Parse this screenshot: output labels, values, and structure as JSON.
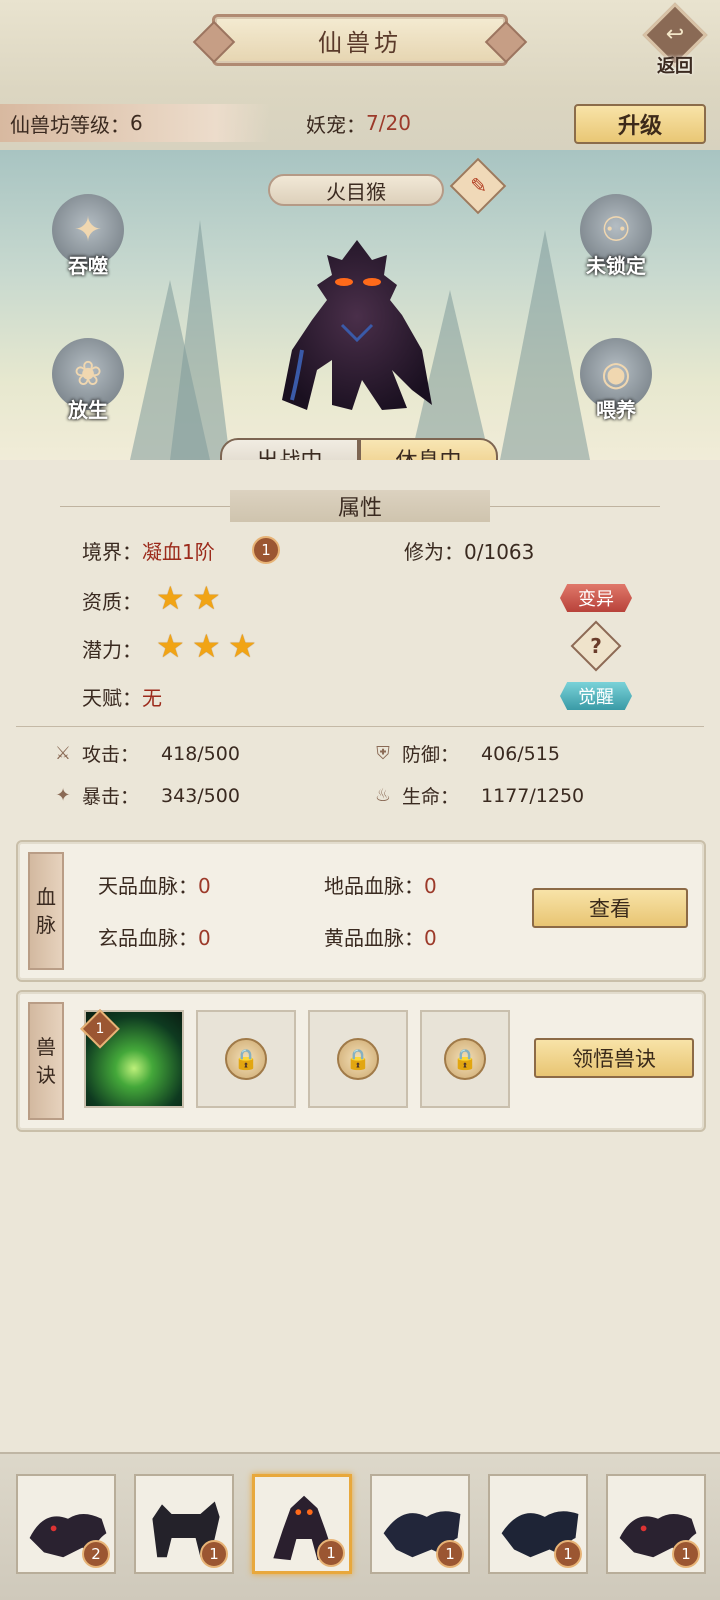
{
  "header": {
    "title": "仙兽坊",
    "back_label": "返回",
    "level_label": "仙兽坊等级：",
    "level_value": "6",
    "pets_label": "妖宠：",
    "pets_value": "7/20",
    "upgrade_label": "升级"
  },
  "scene": {
    "pet_name": "火目猴",
    "actions": {
      "devour": "吞噬",
      "unlocked": "未锁定",
      "release": "放生",
      "feed": "喂养"
    },
    "tabs": {
      "in_battle": "出战中",
      "resting": "休息中",
      "active": "resting"
    }
  },
  "attributes": {
    "section_title": "属性",
    "realm_label": "境界：",
    "realm_value": "凝血1阶",
    "realm_badge": "1",
    "cultivation_label": "修为：",
    "cultivation_value": "0/1063",
    "aptitude_label": "资质：",
    "aptitude_stars": 2,
    "potential_label": "潜力：",
    "potential_stars": 3,
    "talent_label": "天赋：",
    "talent_value": "无",
    "mutate_label": "变异",
    "help_glyph": "?",
    "awaken_label": "觉醒",
    "stats": {
      "attack_label": "攻击：",
      "attack_value": "418/500",
      "defense_label": "防御：",
      "defense_value": "406/515",
      "crit_label": "暴击：",
      "crit_value": "343/500",
      "hp_label": "生命：",
      "hp_value": "1177/1250"
    }
  },
  "bloodline": {
    "tag": [
      "血",
      "脉"
    ],
    "heaven_label": "天品血脉：",
    "heaven_value": "0",
    "earth_label": "地品血脉：",
    "earth_value": "0",
    "mystic_label": "玄品血脉：",
    "mystic_value": "0",
    "yellow_label": "黄品血脉：",
    "yellow_value": "0",
    "view_label": "查看"
  },
  "skills": {
    "tag": [
      "兽",
      "诀"
    ],
    "first_slot_badge": "1",
    "learn_label": "领悟兽诀"
  },
  "roster": {
    "pets": [
      {
        "level": "2"
      },
      {
        "level": "1"
      },
      {
        "level": "1",
        "selected": true
      },
      {
        "level": "1"
      },
      {
        "level": "1"
      },
      {
        "level": "1"
      }
    ]
  },
  "colors": {
    "accent_gold": "#e8c573",
    "value_red": "#9c2b1c",
    "star": "#f1a415",
    "badge": "#9b5632"
  }
}
